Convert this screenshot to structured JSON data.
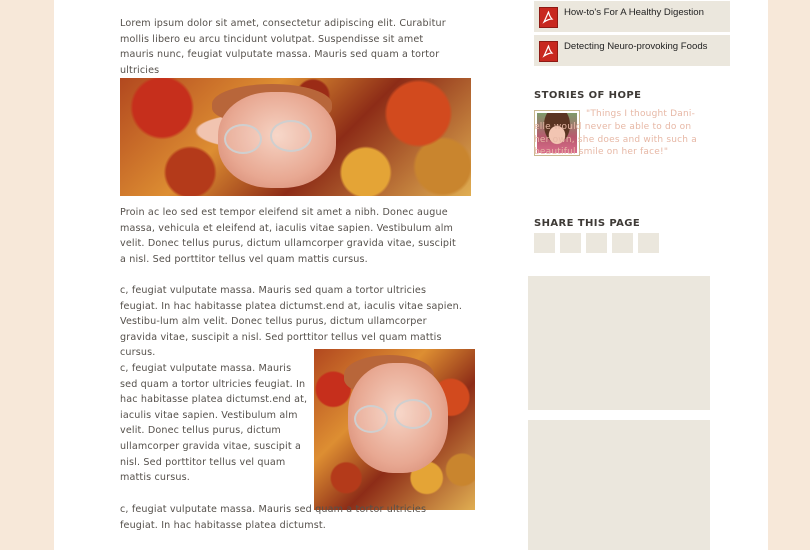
{
  "main": {
    "para1": "Lorem ipsum dolor sit amet, consectetur adipiscing elit. Curabitur mollis libero eu arcu tincidunt volutpat. Suspendisse sit amet mauris nunc, feugiat vulputate massa. Mauris sed quam a tortor ultricies",
    "para2": "Proin ac leo sed est tempor eleifend sit amet a nibh. Donec augue massa, vehicula et eleifend at, iaculis vitae sapien. Vestibulum alm velit. Donec tellus purus, dictum ullamcorper gravida vitae, suscipit a nisl. Sed porttitor tellus vel quam mattis cursus.",
    "para3": "c, feugiat vulputate massa. Mauris sed quam a tortor ultricies feugiat. In hac habitasse platea dictumst.end at, iaculis vitae sapien. Vestibu-lum alm velit. Donec tellus purus, dictum ullamcorper gravida vitae, suscipit a nisl. Sed porttitor tellus vel quam mattis cursus.",
    "para4": "c, feugiat vulputate massa. Mauris sed quam a tortor ultricies feugiat. In hac habitasse platea dictumst.end at, iaculis vitae sapien. Vestibulum alm velit. Donec tellus purus, dictum ullamcorper gravida vitae, suscipit a nisl. Sed porttitor tellus vel quam mattis cursus.",
    "para5": "c, feugiat vulputate massa. Mauris sed quam a tortor ultricies feugiat. In hac habitasse platea dictumst."
  },
  "sidebar": {
    "pdf_links": [
      {
        "label": "How-to's For A Healthy Digestion",
        "icon": "pdf-icon"
      },
      {
        "label": "Detecting Neuro-provoking Foods",
        "icon": "pdf-icon"
      }
    ],
    "stories_heading": "STORIES OF HOPE",
    "story_quote": "\"Things I thought Dani-elle would never be able to do on her own, she does and with such a beautiful smile on her face!\"",
    "share_heading": "SHARE THIS PAGE",
    "share_button_count": 5
  },
  "colors": {
    "background": "#f7e8d9",
    "panel": "#ebe7dd",
    "quote_text": "#e7b8a6",
    "pdf_red": "#c8281f"
  }
}
